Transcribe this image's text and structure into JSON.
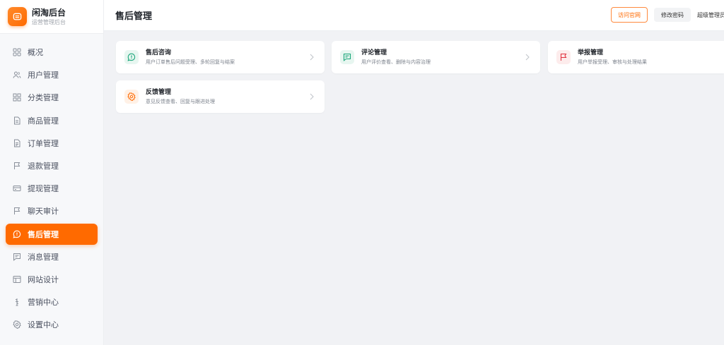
{
  "brand": {
    "title": "闲淘后台",
    "subtitle": "运营管理后台"
  },
  "sidebar": {
    "items": [
      {
        "label": "概况",
        "icon": "grid-icon",
        "active": false
      },
      {
        "label": "用户管理",
        "icon": "users-icon",
        "active": false
      },
      {
        "label": "分类管理",
        "icon": "category-grid-icon",
        "active": false
      },
      {
        "label": "商品管理",
        "icon": "document-icon",
        "active": false
      },
      {
        "label": "订单管理",
        "icon": "order-document-icon",
        "active": false
      },
      {
        "label": "退款管理",
        "icon": "flag-icon",
        "active": false
      },
      {
        "label": "提现管理",
        "icon": "credit-card-icon",
        "active": false
      },
      {
        "label": "聊天审计",
        "icon": "flag-icon",
        "active": false
      },
      {
        "label": "售后管理",
        "icon": "chat-bubble-icon",
        "active": true
      },
      {
        "label": "消息管理",
        "icon": "message-icon",
        "active": false
      },
      {
        "label": "网站设计",
        "icon": "layout-icon",
        "active": false
      },
      {
        "label": "营销中心",
        "icon": "marketing-icon",
        "active": false
      },
      {
        "label": "设置中心",
        "icon": "gear-icon",
        "active": false
      }
    ]
  },
  "header": {
    "title": "售后管理",
    "visit_label": "访问官网",
    "change_password_label": "修改密码",
    "admin_label": "超级管理员"
  },
  "cards": [
    {
      "title": "售后咨询",
      "desc": "用户订单售后问题受理、多轮回复与结案",
      "icon": "chat-bubble-icon",
      "color": "#1aa67a",
      "bg": "#e7f6f0"
    },
    {
      "title": "评论管理",
      "desc": "用户评价查看、删除与内容治理",
      "icon": "message-icon",
      "color": "#1aa67a",
      "bg": "#e7f6f0"
    },
    {
      "title": "举报管理",
      "desc": "用户举报受理、审核与处理结果",
      "icon": "flag-icon",
      "color": "#e0323e",
      "bg": "#fdecec"
    },
    {
      "title": "反馈管理",
      "desc": "意见反馈查看、回复与跟进处理",
      "icon": "gear-icon",
      "color": "#ff6a00",
      "bg": "#fff1e6"
    }
  ],
  "colors": {
    "accent": "#ff6a00",
    "green": "#1aa67a",
    "red": "#e0323e"
  }
}
